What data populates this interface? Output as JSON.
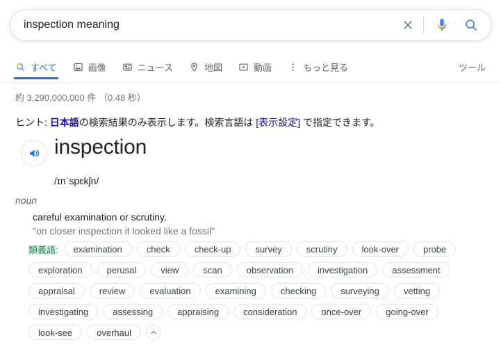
{
  "search": {
    "value": "inspection meaning",
    "placeholder": "検索",
    "clear_icon": "close-icon",
    "mic_icon": "microphone-icon",
    "submit_icon": "search-icon"
  },
  "nav": {
    "tabs": [
      {
        "label": "すべて",
        "icon": "search-icon",
        "active": true
      },
      {
        "label": "画像",
        "icon": "image-icon",
        "active": false
      },
      {
        "label": "ニュース",
        "icon": "news-icon",
        "active": false
      },
      {
        "label": "地図",
        "icon": "map-pin-icon",
        "active": false
      },
      {
        "label": "動画",
        "icon": "video-icon",
        "active": false
      },
      {
        "label": "もっと見る",
        "icon": "more-vertical-icon",
        "active": false
      }
    ],
    "tools_label": "ツール"
  },
  "result_stats": "約 3,290,000,000 件 （0.48 秒）",
  "hint": {
    "prefix": "ヒント: ",
    "link_lang": "日本語",
    "mid": "の検索結果のみ表示します。検索言語は ",
    "link_settings": "[表示設定]",
    "suffix": " で指定できます。"
  },
  "dictionary": {
    "speaker_icon": "speaker-icon",
    "word": "inspection",
    "phonetic": "/ɪnˈspɛkʃn/",
    "part_of_speech": "noun",
    "definition": "careful examination or scrutiny.",
    "example": "\"on closer inspection it looked like a fossil\"",
    "synonyms_label": "類義語:",
    "collapse_icon": "chevron-up-icon",
    "synonym_rows": [
      [
        "examination",
        "check",
        "check-up",
        "survey",
        "scrutiny",
        "look-over",
        "probe"
      ],
      [
        "exploration",
        "perusal",
        "view",
        "scan",
        "observation",
        "investigation",
        "assessment"
      ],
      [
        "appraisal",
        "review",
        "evaluation",
        "examining",
        "checking",
        "surveying",
        "vetting"
      ],
      [
        "investigating",
        "assessing",
        "appraising",
        "consideration",
        "once-over",
        "going-over"
      ],
      [
        "look-see",
        "overhaul"
      ]
    ]
  },
  "colors": {
    "accent_blue": "#1a73e8",
    "link_blue": "#1a0dab",
    "synonym_green": "#0b8043",
    "text_primary": "#202124",
    "text_secondary": "#70757a"
  }
}
